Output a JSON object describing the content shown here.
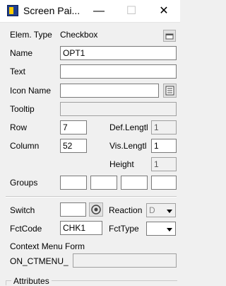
{
  "window": {
    "title": "Screen Pai...",
    "minimize_glyph": "—",
    "maximize_glyph": "☐",
    "close_glyph": "✕"
  },
  "fields": {
    "elem_type_label": "Elem. Type",
    "elem_type_value": "Checkbox",
    "name_label": "Name",
    "name_value": "OPT1",
    "text_label": "Text",
    "text_value": "",
    "icon_name_label": "Icon Name",
    "icon_name_value": "",
    "tooltip_label": "Tooltip",
    "tooltip_value": "",
    "row_label": "Row",
    "row_value": "7",
    "def_length_label": "Def.Lengtl",
    "def_length_value": "1",
    "column_label": "Column",
    "column_value": "52",
    "vis_length_label": "Vis.Lengtl",
    "vis_length_value": "1",
    "height_label": "Height",
    "height_value": "1",
    "groups_label": "Groups",
    "groups_values": [
      "",
      "",
      "",
      ""
    ],
    "switch_label": "Switch",
    "switch_value": "",
    "reaction_label": "Reaction",
    "reaction_value": "D",
    "fctcode_label": "FctCode",
    "fctcode_value": "CHK1",
    "fcttype_label": "FctType",
    "fcttype_value": "",
    "context_menu_label": "Context Menu Form",
    "context_menu_prefix": "ON_CTMENU_",
    "context_menu_value": "",
    "attributes_label": "Attributes"
  },
  "icons": {
    "app": "screen-painter-icon",
    "elem_type_button": "window-icon",
    "icon_picker": "list-icon",
    "switch_button": "radio-target-icon"
  }
}
